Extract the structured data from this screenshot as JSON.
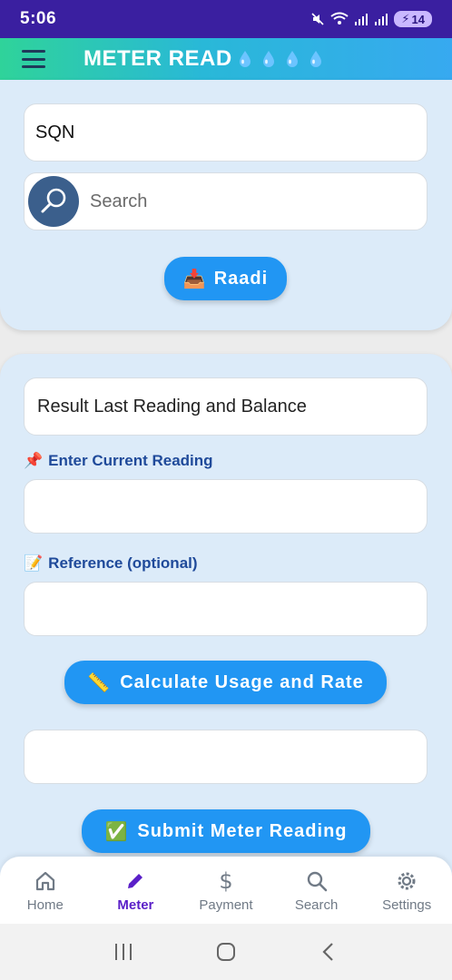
{
  "status_bar": {
    "time": "5:06",
    "battery": "14"
  },
  "app_bar": {
    "title": "METER READ"
  },
  "search_card": {
    "sqn_value": "SQN",
    "search_placeholder": "Search",
    "raadi_label": "Raadi",
    "raadi_emoji": "📥"
  },
  "reading_card": {
    "result_text": "Result Last Reading and Balance",
    "current_reading_label": "Enter Current Reading",
    "current_reading_emoji": "📌",
    "reference_label": "Reference (optional)",
    "reference_emoji": "📝",
    "calculate_label": "Calculate Usage and Rate",
    "calculate_emoji": "📏",
    "submit_label": "Submit Meter Reading",
    "submit_emoji": "✅"
  },
  "bottom_nav": [
    {
      "label": "Home",
      "icon": "home-icon"
    },
    {
      "label": "Meter",
      "icon": "pencil-icon",
      "active": true
    },
    {
      "label": "Payment",
      "icon": "dollar-icon"
    },
    {
      "label": "Search",
      "icon": "search-icon"
    },
    {
      "label": "Settings",
      "icon": "gear-icon"
    }
  ],
  "colors": {
    "accent": "#2196f3",
    "active_nav": "#5a1fc8",
    "card_bg": "#dcebf9",
    "status_bar": "#3a1fa0"
  }
}
